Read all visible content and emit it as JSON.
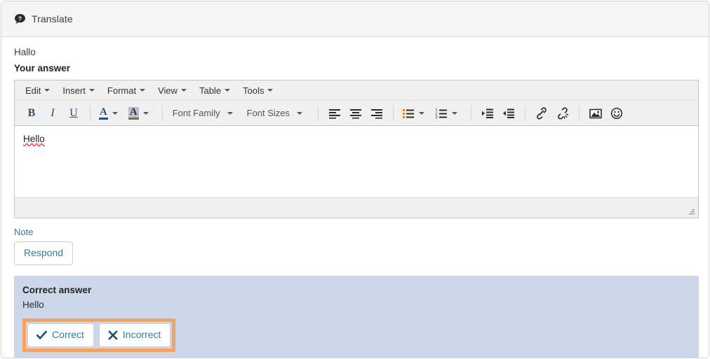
{
  "header": {
    "icon": "question-speech-bubble-icon",
    "title": "Translate"
  },
  "body": {
    "prompt": "Hallo",
    "answer_label": "Your answer"
  },
  "editor": {
    "menubar": [
      {
        "label": "Edit"
      },
      {
        "label": "Insert"
      },
      {
        "label": "Format"
      },
      {
        "label": "View"
      },
      {
        "label": "Table"
      },
      {
        "label": "Tools"
      }
    ],
    "toolbar": {
      "bold": "B",
      "italic": "I",
      "underline": "U",
      "forecolor": "A",
      "backcolor": "A",
      "font_family": "Font Family",
      "font_sizes": "Font Sizes"
    },
    "content": "Hello"
  },
  "note": {
    "label": "Note",
    "respond_label": "Respond"
  },
  "answer_panel": {
    "title": "Correct answer",
    "text": "Hello",
    "correct_label": "Correct",
    "incorrect_label": "Incorrect",
    "highlight_color": "#f4a460",
    "background_color": "#ccd8e9"
  }
}
